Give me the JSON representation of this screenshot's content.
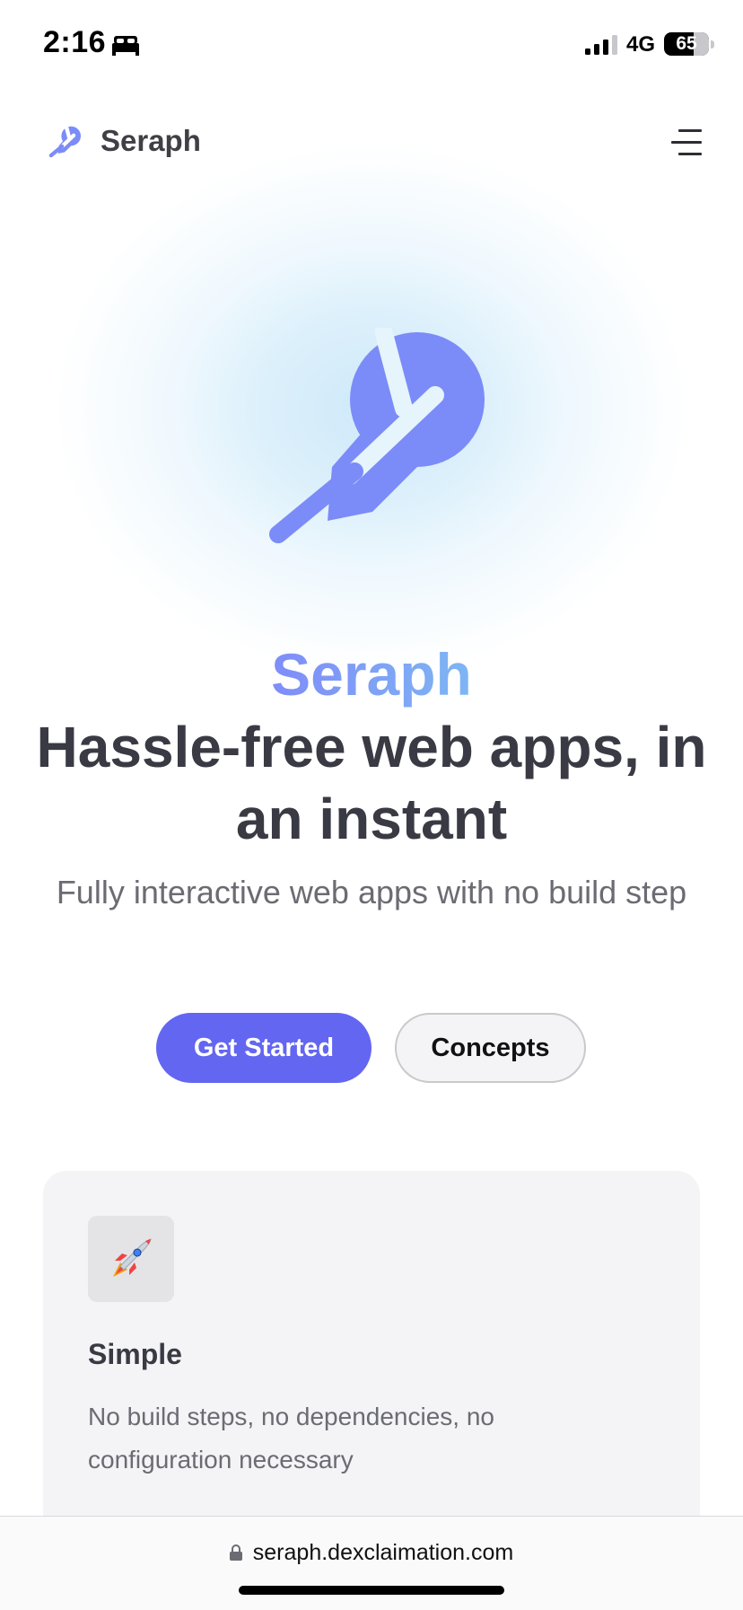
{
  "status_bar": {
    "time": "2:16",
    "network": "4G",
    "battery_level": "65",
    "battery_fraction": 0.65,
    "sleep_icon": "bed-icon",
    "signal_icon": "signal-bars-icon"
  },
  "header": {
    "brand_name": "Seraph",
    "logo_icon": "feather-icon",
    "menu_icon": "hamburger-menu-icon"
  },
  "hero": {
    "brand": "Seraph",
    "title": "Hassle-free web apps, in an instant",
    "subtitle": "Fully interactive web apps with no build step",
    "primary_button": "Get Started",
    "secondary_button": "Concepts"
  },
  "features": [
    {
      "icon": "rocket-icon",
      "title": "Simple",
      "description": "No build steps, no dependencies, no configuration necessary"
    }
  ],
  "browser": {
    "url": "seraph.dexclaimation.com"
  },
  "colors": {
    "accent": "#6366f1",
    "logo": "#7b8cf8",
    "text": "#3f3f46",
    "muted": "#6b6b73",
    "card": "#f4f4f6"
  }
}
